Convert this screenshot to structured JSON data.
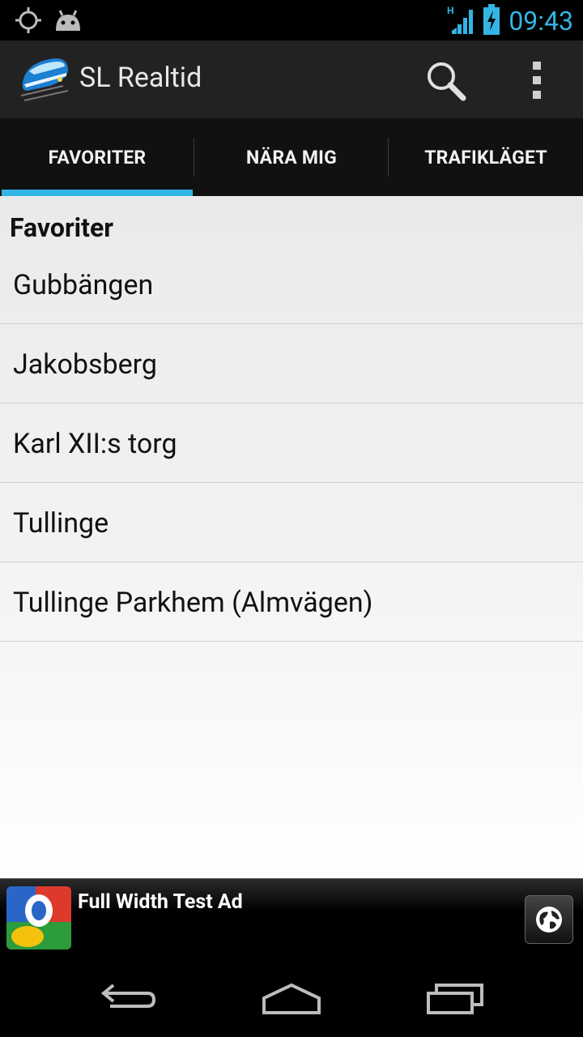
{
  "status_bar": {
    "time": "09:43",
    "network_type": "H",
    "icons": [
      "gps-icon",
      "android-debug-icon",
      "signal-icon",
      "battery-charging-icon"
    ]
  },
  "action_bar": {
    "title": "SL Realtid",
    "icons": [
      "app-logo-train-icon",
      "search-icon",
      "overflow-menu-icon"
    ]
  },
  "tabs": [
    {
      "label": "FAVORITER",
      "selected": true
    },
    {
      "label": "NÄRA MIG",
      "selected": false
    },
    {
      "label": "TRAFIKLÄGET",
      "selected": false
    }
  ],
  "favorites": {
    "header": "Favoriter",
    "items": [
      {
        "label": "Gubbängen"
      },
      {
        "label": "Jakobsberg"
      },
      {
        "label": "Karl XII:s torg"
      },
      {
        "label": "Tullinge"
      },
      {
        "label": "Tullinge Parkhem (Almvägen)"
      }
    ]
  },
  "ad": {
    "title": "Full Width Test Ad",
    "icons": [
      "google-logo-icon",
      "globe-icon"
    ]
  },
  "nav_bar": {
    "icons": [
      "back-icon",
      "home-icon",
      "recent-apps-icon"
    ]
  },
  "colors": {
    "accent": "#33b5e5",
    "action_bar_bg": "#222222",
    "tab_bar_bg": "#111111",
    "content_bg": "#eeeeee"
  }
}
